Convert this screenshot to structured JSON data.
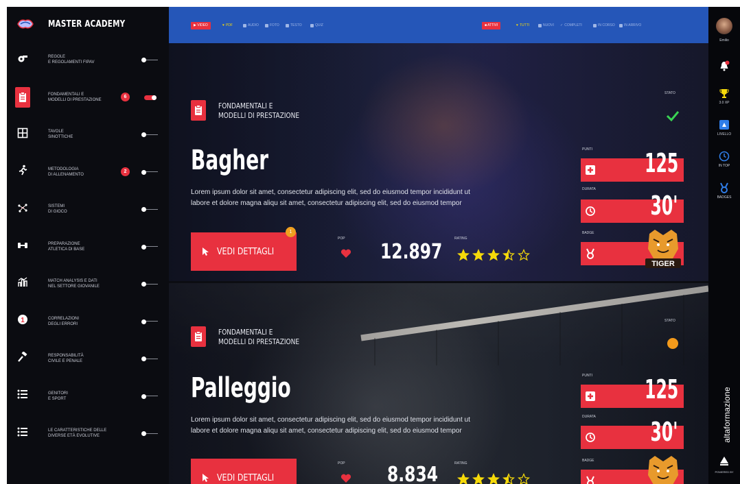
{
  "brand": {
    "title": "MASTER ACADEMY"
  },
  "sidebar": {
    "items": [
      {
        "line1": "REGOLE",
        "line2": "E REGOLAMENTI FIPAV",
        "icon": "whistle-icon",
        "badge": "",
        "toggle": "off",
        "active": false
      },
      {
        "line1": "FONDAMENTALI E",
        "line2": "MODELLI DI PRESTAZIONE",
        "icon": "clipboard-icon",
        "badge": "6",
        "toggle": "on",
        "active": true
      },
      {
        "line1": "TAVOLE",
        "line2": "SINOTTICHE",
        "icon": "table-icon",
        "badge": "",
        "toggle": "off",
        "active": false
      },
      {
        "line1": "METODOLOGIA",
        "line2": "DI ALLENAMENTO",
        "icon": "runner-icon",
        "badge": "2",
        "toggle": "off",
        "active": false
      },
      {
        "line1": "SISTEMI",
        "line2": "DI GIOCO",
        "icon": "network-icon",
        "badge": "",
        "toggle": "off",
        "active": false
      },
      {
        "line1": "PREPARAZIONE",
        "line2": "ATLETICA DI BASE",
        "icon": "dumbbell-icon",
        "badge": "",
        "toggle": "off",
        "active": false
      },
      {
        "line1": "MATCH ANALYSIS E DATI",
        "line2": "NEL SETTORE GIOVANILE",
        "icon": "chart-icon",
        "badge": "",
        "toggle": "off",
        "active": false
      },
      {
        "line1": "CORRELAZIONI",
        "line2": "DEGLI ERRORI",
        "icon": "alert-icon",
        "badge": "",
        "toggle": "off",
        "active": false
      },
      {
        "line1": "RESPONSABILITÀ",
        "line2": "CIVILE E PENALE",
        "icon": "gavel-icon",
        "badge": "",
        "toggle": "off",
        "active": false
      },
      {
        "line1": "GENITORI",
        "line2": "E SPORT",
        "icon": "list-icon",
        "badge": "",
        "toggle": "off",
        "active": false
      },
      {
        "line1": "LE CARATTERISTICHE DELLE",
        "line2": "DIVERSE ETÀ EVOLUTIVE",
        "icon": "list-icon",
        "badge": "",
        "toggle": "off",
        "active": false
      }
    ]
  },
  "topbar": {
    "left_button": "VIDEO",
    "left_items": [
      "PDF",
      "AUDIO",
      "FOTO",
      "TESTO",
      "QUIZ"
    ],
    "right_button": "ATTIVI",
    "right_items": [
      "TUTTI",
      "NUOVI",
      "COMPLETI",
      "IN CORSO",
      "IN ARRIVO"
    ]
  },
  "rail": {
    "user": "Emilio",
    "xp": "3.0 XP",
    "level": "LIVELLO",
    "time": "IN TOP",
    "badges": "BADGES",
    "logo_text": "altaformazione",
    "footer": "POWERED BY"
  },
  "cards": [
    {
      "category_line1": "FONDAMENTALI E",
      "category_line2": "MODELLI DI PRESTAZIONE",
      "title": "Bagher",
      "desc_line1": "Lorem ipsum dolor sit amet, consectetur adipiscing elit, sed do eiusmod tempor incididunt ut",
      "desc_line2": "labore et dolore magna aliqu sit amet, consectetur adipiscing elit, sed do eiusmod tempor",
      "cta": "VEDI DETTAGLI",
      "cta_badge": "1",
      "pop_label": "POP",
      "popularity": "12.897",
      "rating_label": "RATING",
      "rating": 3.5,
      "state_label": "STATO",
      "state": "completed",
      "points_label": "PUNTI",
      "points": "125",
      "duration_label": "DURATA",
      "duration": "30'",
      "badge_label": "BADGE",
      "badge_name": "TIGER"
    },
    {
      "category_line1": "FONDAMENTALI E",
      "category_line2": "MODELLI DI PRESTAZIONE",
      "title": "Palleggio",
      "desc_line1": "Lorem ipsum dolor sit amet, consectetur adipiscing elit, sed do eiusmod tempor incididunt ut",
      "desc_line2": "labore et dolore magna aliqu sit amet, consectetur adipiscing elit, sed do eiusmod tempor",
      "cta": "VEDI DETTAGLI",
      "cta_badge": "",
      "pop_label": "POP",
      "popularity": "8.834",
      "rating_label": "RATING",
      "rating": 3.5,
      "state_label": "STATO",
      "state": "in-progress",
      "points_label": "PUNTI",
      "points": "125",
      "duration_label": "DURATA",
      "duration": "30'",
      "badge_label": "BADGE",
      "badge_name": "TIGER"
    }
  ],
  "colors": {
    "accent": "#e8313f",
    "topbar": "#2556b8",
    "sidebar": "#0b0c11",
    "star": "#f5d90a",
    "check": "#39d353",
    "progress": "#f39a1b"
  }
}
